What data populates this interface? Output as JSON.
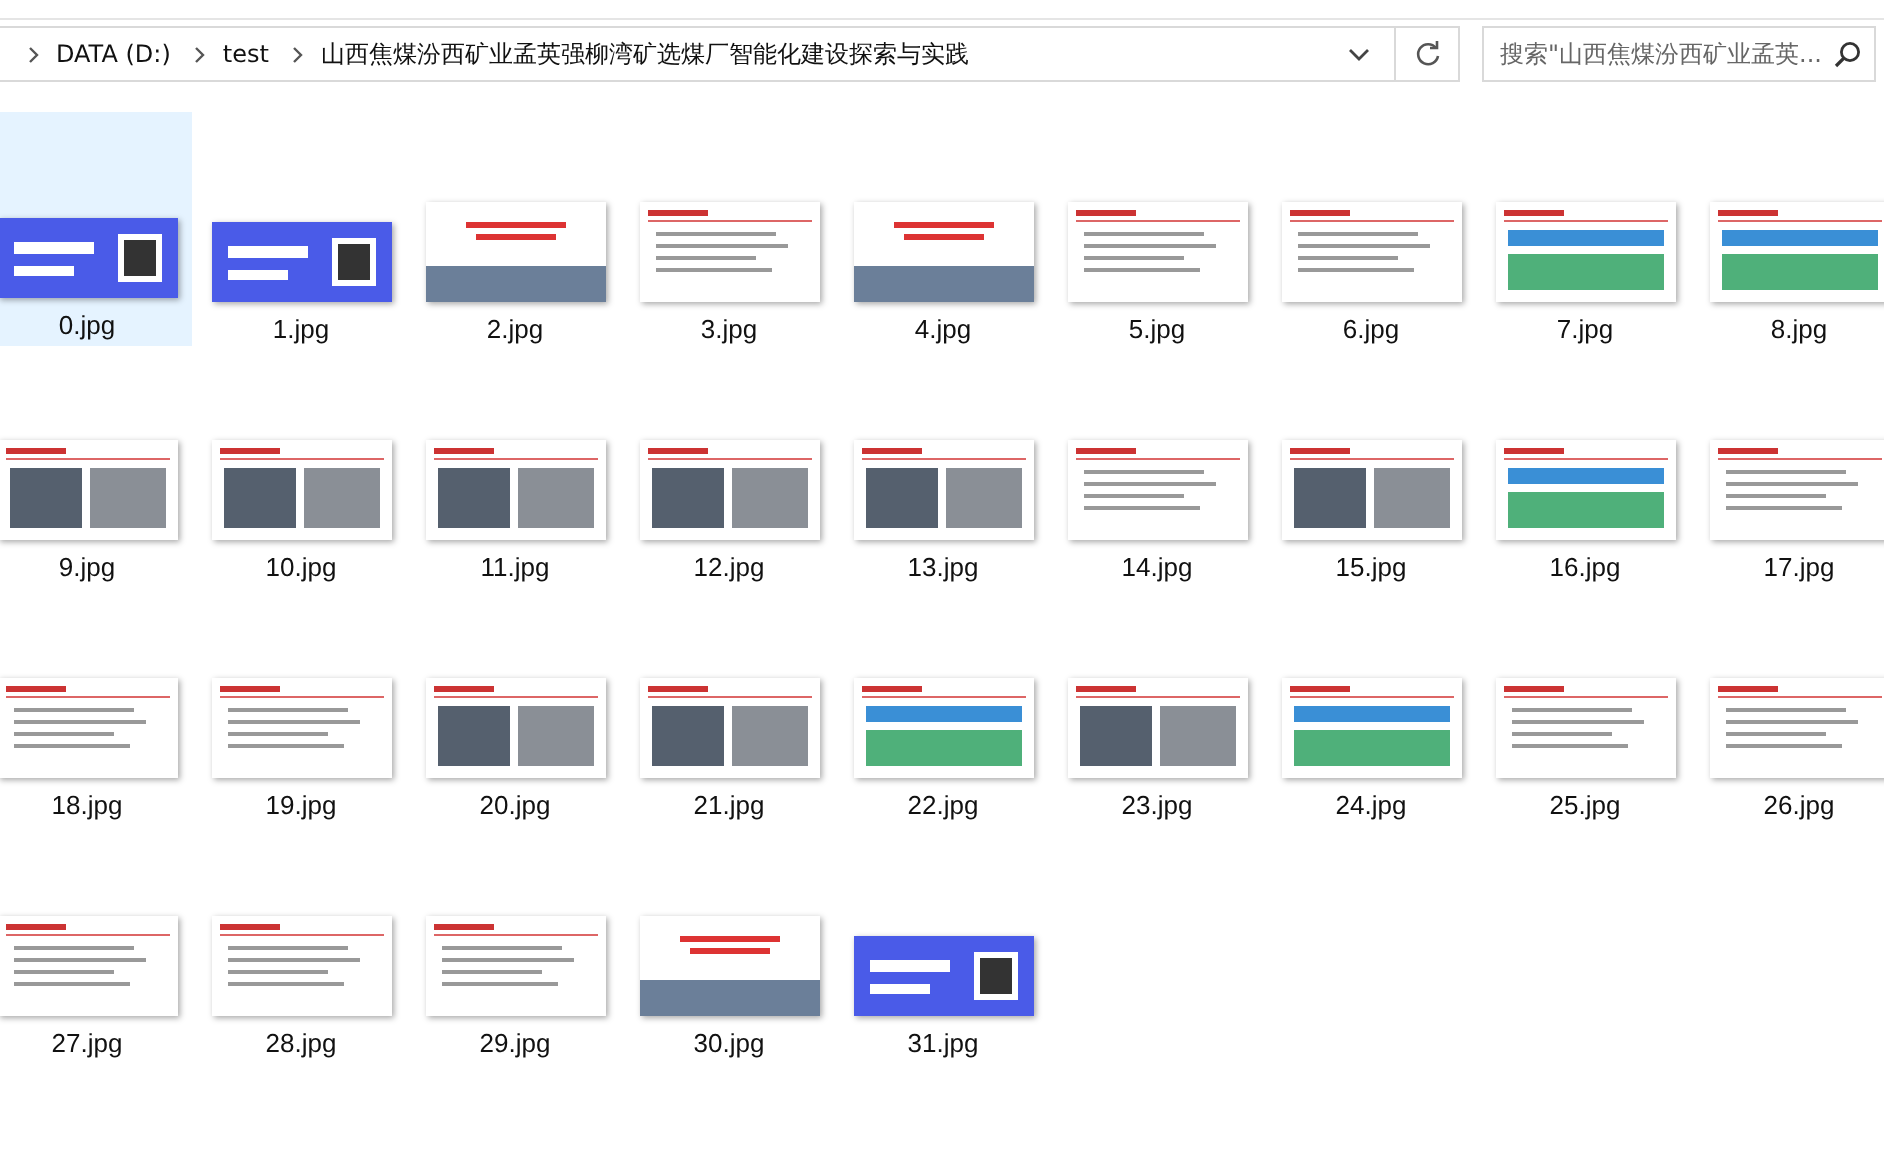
{
  "address_bar": {
    "path": [
      {
        "label": "DATA (D:)"
      },
      {
        "label": "test"
      },
      {
        "label": "山西焦煤汾西矿业孟英强柳湾矿选煤厂智能化建设探索与实践"
      }
    ]
  },
  "search": {
    "placeholder": "搜索\"山西焦煤汾西矿业孟英..."
  },
  "files": [
    {
      "name": "0.jpg",
      "kind": "banner",
      "selected": true
    },
    {
      "name": "1.jpg",
      "kind": "banner",
      "selected": false
    },
    {
      "name": "2.jpg",
      "kind": "cover",
      "selected": false
    },
    {
      "name": "3.jpg",
      "kind": "slide",
      "selected": false
    },
    {
      "name": "4.jpg",
      "kind": "cover",
      "selected": false
    },
    {
      "name": "5.jpg",
      "kind": "slide",
      "selected": false
    },
    {
      "name": "6.jpg",
      "kind": "slide",
      "selected": false
    },
    {
      "name": "7.jpg",
      "kind": "diagram",
      "selected": false
    },
    {
      "name": "8.jpg",
      "kind": "diagram",
      "selected": false
    },
    {
      "name": "9.jpg",
      "kind": "photo",
      "selected": false
    },
    {
      "name": "10.jpg",
      "kind": "photo",
      "selected": false
    },
    {
      "name": "11.jpg",
      "kind": "photo",
      "selected": false
    },
    {
      "name": "12.jpg",
      "kind": "photo",
      "selected": false
    },
    {
      "name": "13.jpg",
      "kind": "photo",
      "selected": false
    },
    {
      "name": "14.jpg",
      "kind": "slide",
      "selected": false
    },
    {
      "name": "15.jpg",
      "kind": "photo",
      "selected": false
    },
    {
      "name": "16.jpg",
      "kind": "diagram",
      "selected": false
    },
    {
      "name": "17.jpg",
      "kind": "slide",
      "selected": false
    },
    {
      "name": "18.jpg",
      "kind": "slide",
      "selected": false
    },
    {
      "name": "19.jpg",
      "kind": "slide",
      "selected": false
    },
    {
      "name": "20.jpg",
      "kind": "photo",
      "selected": false
    },
    {
      "name": "21.jpg",
      "kind": "photo",
      "selected": false
    },
    {
      "name": "22.jpg",
      "kind": "diagram",
      "selected": false
    },
    {
      "name": "23.jpg",
      "kind": "photo",
      "selected": false
    },
    {
      "name": "24.jpg",
      "kind": "diagram",
      "selected": false
    },
    {
      "name": "25.jpg",
      "kind": "slide",
      "selected": false
    },
    {
      "name": "26.jpg",
      "kind": "slide",
      "selected": false
    },
    {
      "name": "27.jpg",
      "kind": "slide",
      "selected": false
    },
    {
      "name": "28.jpg",
      "kind": "slide",
      "selected": false
    },
    {
      "name": "29.jpg",
      "kind": "slide",
      "selected": false
    },
    {
      "name": "30.jpg",
      "kind": "cover",
      "selected": false
    },
    {
      "name": "31.jpg",
      "kind": "banner",
      "selected": false
    }
  ]
}
